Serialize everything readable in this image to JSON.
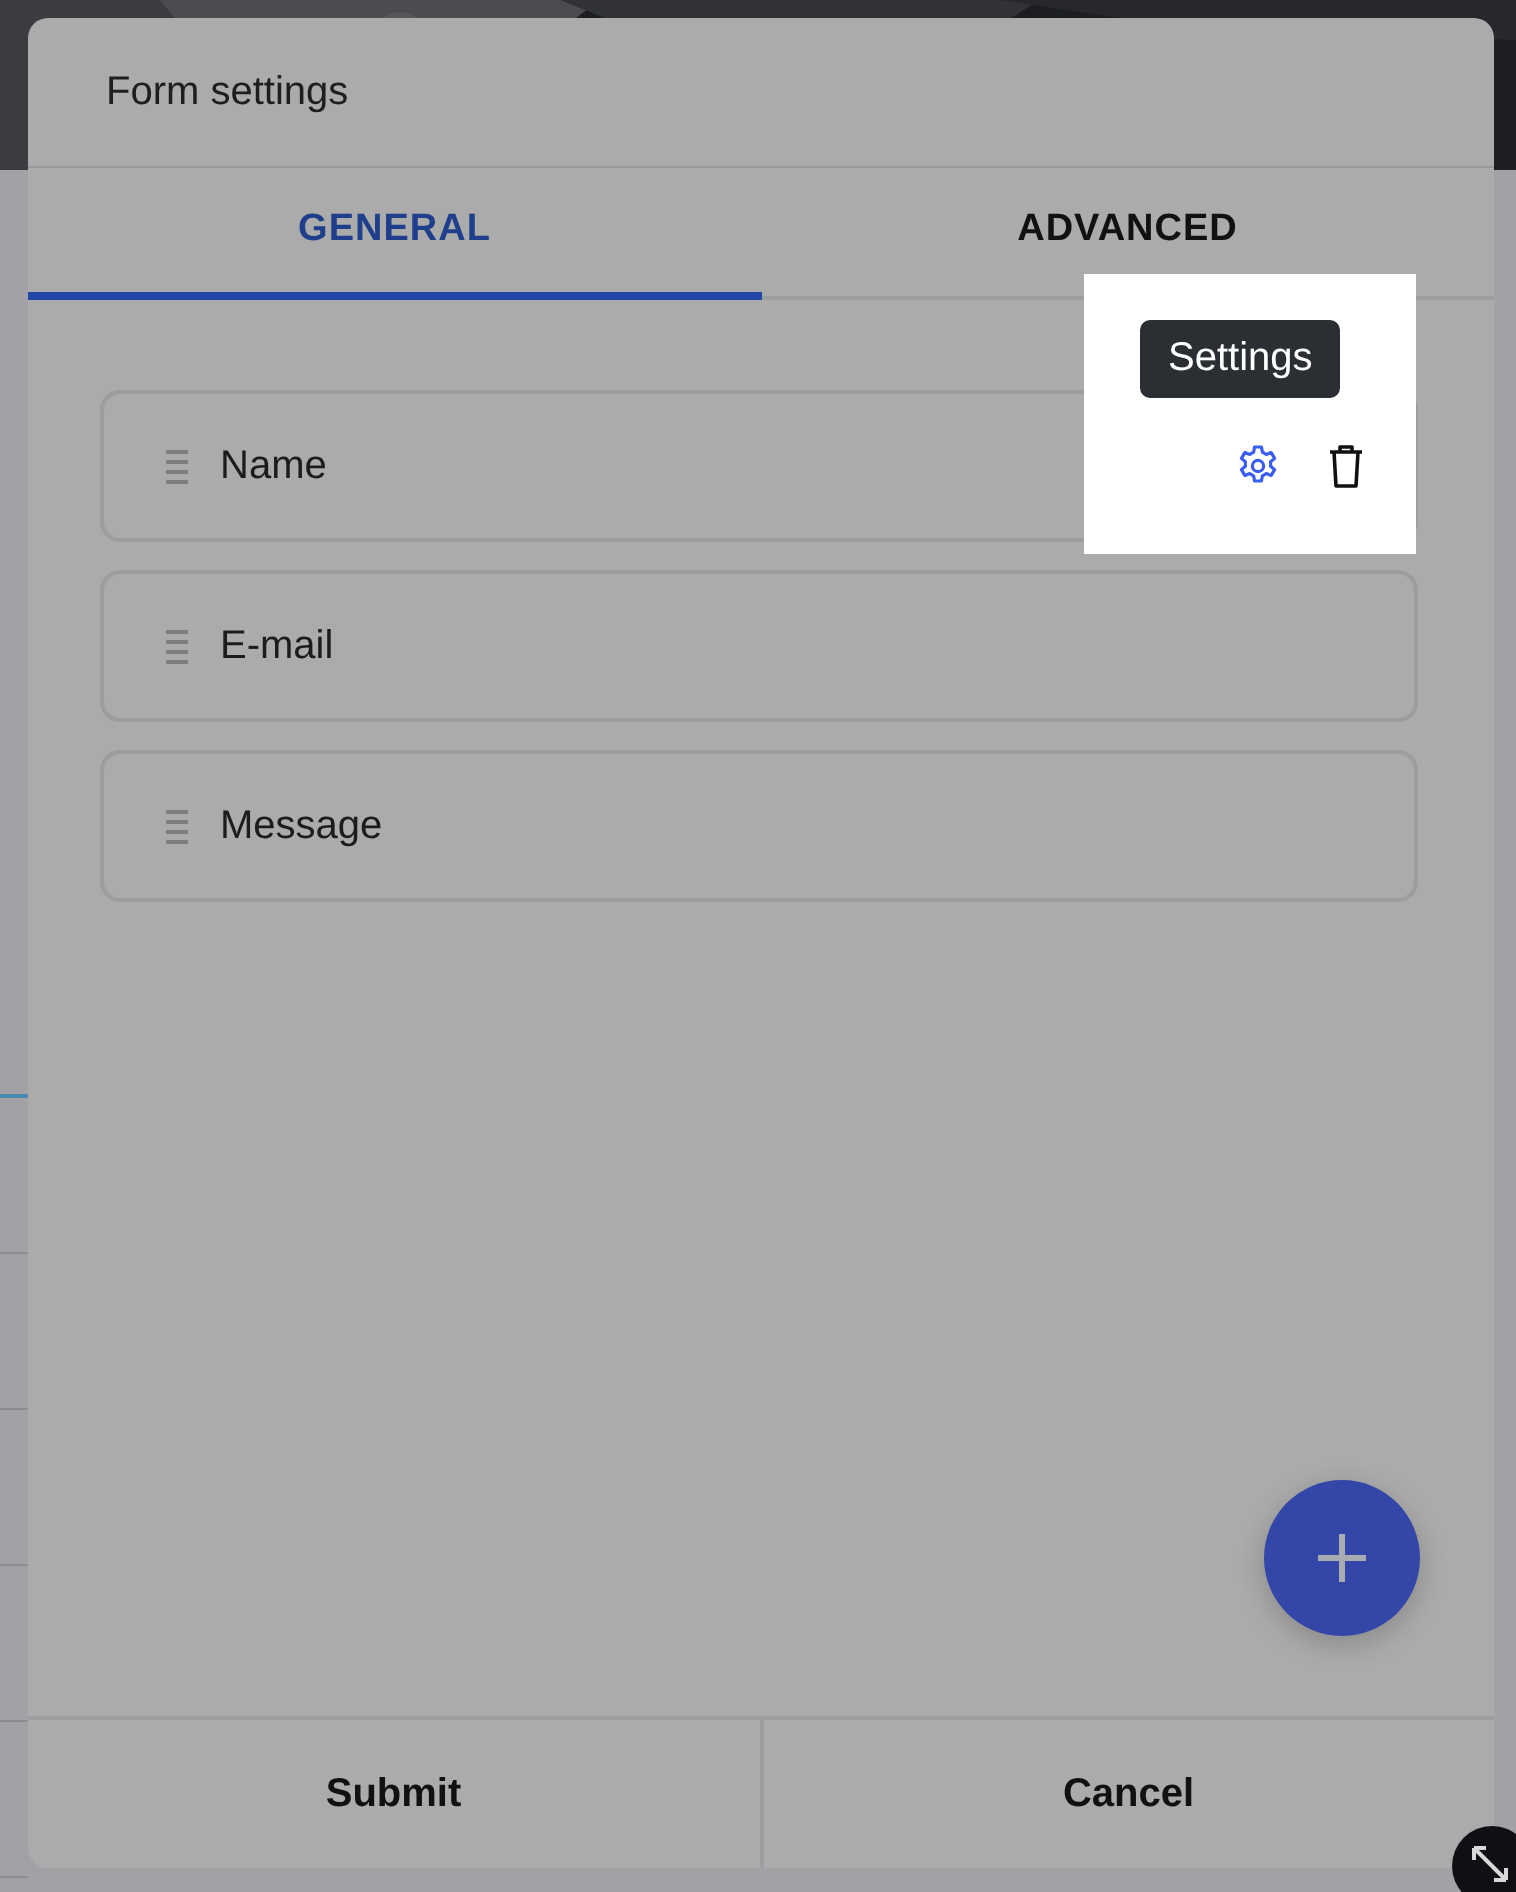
{
  "dialog": {
    "title": "Form settings"
  },
  "tabs": [
    {
      "label": "GENERAL",
      "selected": true
    },
    {
      "label": "ADVANCED",
      "selected": false
    }
  ],
  "fields": [
    {
      "label": "Name",
      "highlighted": true
    },
    {
      "label": "E-mail",
      "highlighted": false
    },
    {
      "label": "Message",
      "highlighted": false
    }
  ],
  "tooltip": "Settings",
  "buttons": [
    "Submit",
    "Cancel"
  ]
}
